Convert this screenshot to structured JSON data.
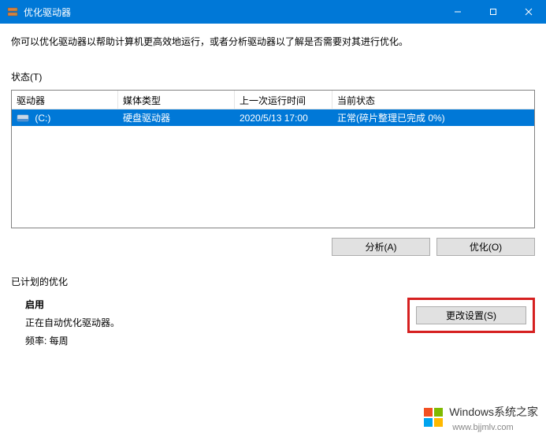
{
  "titlebar": {
    "title": "优化驱动器"
  },
  "description": "你可以优化驱动器以帮助计算机更高效地运行，或者分析驱动器以了解是否需要对其进行优化。",
  "status_label": "状态(T)",
  "table": {
    "headers": {
      "drive": "驱动器",
      "media": "媒体类型",
      "lastrun": "上一次运行时间",
      "status": "当前状态"
    },
    "rows": [
      {
        "drive": "(C:)",
        "media": "硬盘驱动器",
        "lastrun": "2020/5/13 17:00",
        "status": "正常(碎片整理已完成 0%)"
      }
    ]
  },
  "buttons": {
    "analyze": "分析(A)",
    "optimize": "优化(O)"
  },
  "scheduled": {
    "title": "已计划的优化",
    "enabled": "启用",
    "desc": "正在自动优化驱动器。",
    "freq_label": "频率: 每周",
    "change_settings": "更改设置(S)"
  },
  "watermark": {
    "text": "Windows系统之家",
    "url": "www.bjjmlv.com"
  }
}
